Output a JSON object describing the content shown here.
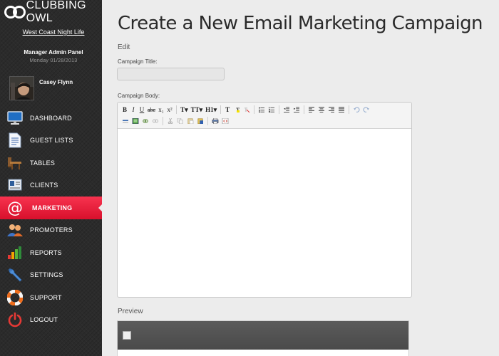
{
  "app": {
    "logo_text": "CLUBBING OWL",
    "venue_link": "West Coast Night Life",
    "admin_title": "Manager Admin Panel",
    "admin_date": "Monday 01/28/2013"
  },
  "user": {
    "name": "Casey Flynn"
  },
  "nav": {
    "items": [
      {
        "label": "DASHBOARD",
        "icon": "monitor-icon"
      },
      {
        "label": "GUEST LISTS",
        "icon": "document-icon"
      },
      {
        "label": "TABLES",
        "icon": "table-icon"
      },
      {
        "label": "CLIENTS",
        "icon": "address-book-icon"
      },
      {
        "label": "MARKETING",
        "icon": "at-sign-icon",
        "active": true
      },
      {
        "label": "PROMOTERS",
        "icon": "people-icon"
      },
      {
        "label": "REPORTS",
        "icon": "bar-chart-icon"
      },
      {
        "label": "SETTINGS",
        "icon": "wrench-icon"
      },
      {
        "label": "SUPPORT",
        "icon": "lifebuoy-icon"
      },
      {
        "label": "LOGOUT",
        "icon": "power-icon"
      }
    ]
  },
  "main": {
    "page_title": "Create a New Email Marketing Campaign",
    "edit_heading": "Edit",
    "title_label": "Campaign Title:",
    "title_value": "",
    "body_label": "Campaign Body:",
    "preview_heading": "Preview"
  },
  "toolbar": {
    "bold": "B",
    "italic": "I",
    "underline": "U",
    "strike": "abc",
    "subscript": "x₁",
    "superscript": "x²",
    "font": "T▾",
    "size": "TT▾",
    "heading": "H1▾",
    "format": "T"
  },
  "colors": {
    "accent": "#e81a37",
    "sidebar_bg": "#2b2b2b",
    "page_bg": "#ececec"
  }
}
